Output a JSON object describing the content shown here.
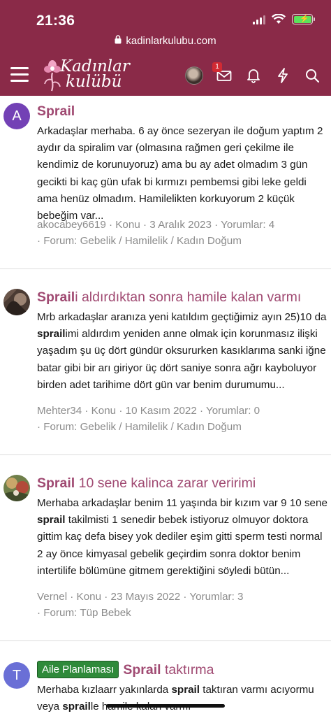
{
  "status_bar": {
    "time": "21:36"
  },
  "browser": {
    "url": "kadinlarkulubu.com"
  },
  "site": {
    "logo_line1": "Kadınlar",
    "logo_line2": "kulübü",
    "notification_badge": "1",
    "brand_color": "#8a2a48",
    "title_color": "#a04a72"
  },
  "results": [
    {
      "avatar_letter": "A",
      "avatar_color": "#7341b5",
      "title_highlight": "Sprail",
      "title_rest": "",
      "body": "Arkadaşlar merhaba. 6 ay önce sezeryan ile doğum yaptım 2 aydır da spiralim var (olmasına rağmen geri çekilme ile kendimiz de korunuyoruz) ama bu ay adet olmadım 3 gün gecikti bi kaç gün ufak bi kırmızı pembemsi gibi leke geldi ama henüz olmadım. Hamilelikten korkuyorum 2 küçük bebeğim var...",
      "meta_line1": "akocabey6619 · Konu · 3 Aralık 2023 · Yorumlar: 4",
      "meta_line2": "· Forum: Gebelik / Hamilelik / Kadın Doğum"
    },
    {
      "avatar_letter": "",
      "title_highlight": "Sprail",
      "title_rest": "i aldırdıktan sonra hamile kalan varmı",
      "body_parts": [
        "Mrb arkadaşlar aranıza yeni katıldım geçtiğimiz ayın 25)10 da ",
        "sprail",
        "imi aldırdım yeniden anne olmak için korunmasız ilişki yaşadım şu üç dört gündür oksururken kasıklarıma sanki iğne batar gibi bir arı giriyor üç dört saniye sonra ağrı kayboluyor birden adet tarihime dört gün var benim durumumu..."
      ],
      "meta_line1": "Mehter34 · Konu · 10 Kasım 2022 · Yorumlar: 0",
      "meta_line2": "· Forum: Gebelik / Hamilelik / Kadın Doğum"
    },
    {
      "avatar_letter": "",
      "title_highlight": "Sprail",
      "title_rest": " 10 sene kalinca zarar veririmi",
      "body_parts": [
        "Merhaba arkadaşlar benim 11 yaşında bir kızım var 9 10 sene ",
        "sprail",
        " takilmisti 1 senedir bebek istiyoruz olmuyor doktora gittim kaç defa bisey yok dediler eşim gitti sperm testi normal 2 ay önce kimyasal gebelik geçirdim sonra doktor benim intertilife bölümüne gitmem gerektiğini söyledi bütün..."
      ],
      "meta_line1": "Vernel · Konu · 23 Mayıs 2022 · Yorumlar: 3",
      "meta_line2": "· Forum: Tüp Bebek"
    },
    {
      "avatar_letter": "T",
      "avatar_color": "#6a6fd6",
      "prefix": "Aile Planlaması",
      "title_highlight": "Sprail",
      "title_rest": " taktırma",
      "body_parts": [
        "Merhaba kızlaarr yakınlarda ",
        "sprail",
        " taktıran varmı acıyormu veya ",
        "sprail",
        "le hamile kalan varmı"
      ]
    }
  ]
}
